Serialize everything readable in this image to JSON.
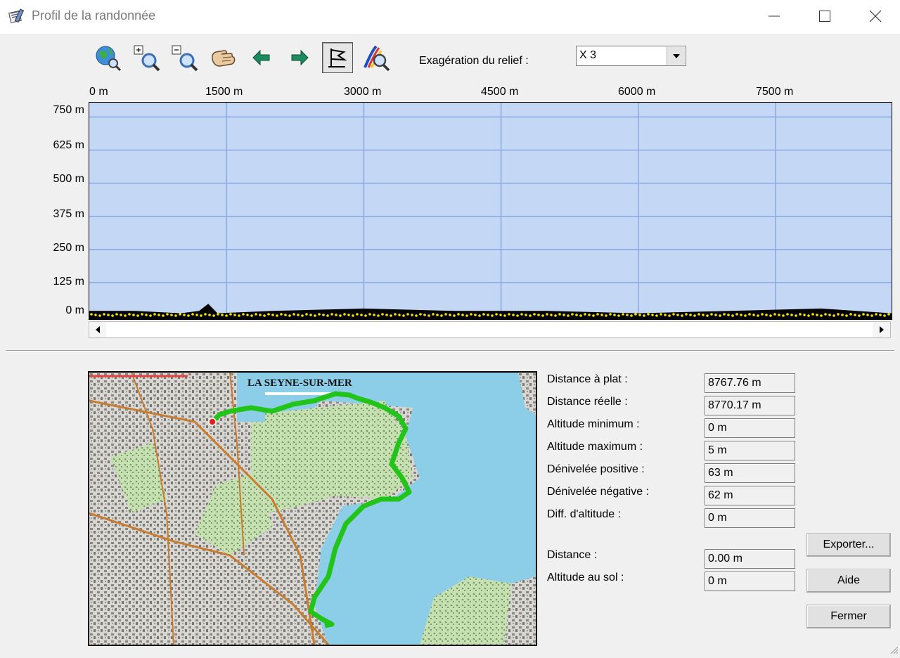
{
  "window": {
    "title": "Profil de la randonnée"
  },
  "toolbar": {
    "buttons": [
      {
        "icon": "globe-zoom-icon"
      },
      {
        "icon": "zoom-in-icon"
      },
      {
        "icon": "zoom-out-icon"
      },
      {
        "icon": "pan-hand-icon"
      },
      {
        "icon": "arrow-left-icon"
      },
      {
        "icon": "arrow-right-icon"
      },
      {
        "icon": "flag-icon",
        "pressed": true
      },
      {
        "icon": "profile-zoom-icon"
      }
    ],
    "relief_label": "Exagération du relief :",
    "relief_value": "X 3"
  },
  "chart_data": {
    "type": "area",
    "x_ticks": [
      "0 m",
      "1500 m",
      "3000 m",
      "4500 m",
      "6000 m",
      "7500 m"
    ],
    "y_ticks": [
      "750 m",
      "625 m",
      "500 m",
      "375 m",
      "250 m",
      "125 m",
      "0 m"
    ],
    "xlim": [
      0,
      8767.76
    ],
    "ylim": [
      0,
      775
    ],
    "grid": true,
    "x": [
      0,
      500,
      1000,
      1200,
      1300,
      1400,
      2000,
      3000,
      4000,
      5000,
      6000,
      7000,
      8000,
      8767.76
    ],
    "y": [
      2,
      2,
      1,
      2,
      5,
      1,
      2,
      3,
      2,
      2,
      1,
      2,
      3,
      1
    ],
    "colors": {
      "background": "#c4d8f6",
      "grid": "#8aa8e0",
      "profile": "#000000",
      "markers": "#f5e400"
    }
  },
  "stats": [
    {
      "label": "Distance à plat :",
      "value": "8767.76 m"
    },
    {
      "label": "Distance réelle :",
      "value": "8770.17 m"
    },
    {
      "label": "Altitude minimum :",
      "value": "0 m"
    },
    {
      "label": "Altitude maximum :",
      "value": "5 m"
    },
    {
      "label": "Dénivelée positive :",
      "value": "63 m"
    },
    {
      "label": "Dénivelée négative :",
      "value": "62 m"
    },
    {
      "label": "Diff. d'altitude :",
      "value": "0 m"
    },
    {
      "label": "Distance :",
      "value": "0.00 m"
    },
    {
      "label": "Altitude au sol :",
      "value": "0 m"
    }
  ],
  "map": {
    "place_label": "LA SEYNE-SUR-MER",
    "route_color": "#22c41a"
  },
  "buttons": {
    "export": "Exporter...",
    "help": "Aide",
    "close": "Fermer"
  }
}
